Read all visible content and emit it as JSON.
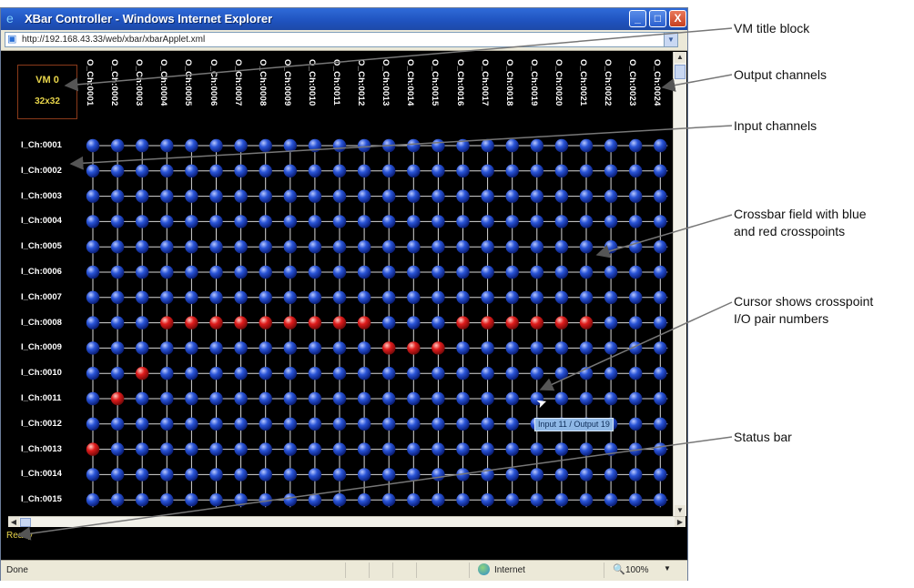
{
  "window": {
    "title": "XBar Controller - Windows Internet Explorer",
    "url": "http://192.168.43.33/web/xbar/xbarApplet.xml",
    "min_label": "_",
    "max_label": "□",
    "close_label": "X"
  },
  "vm": {
    "name": "VM 0",
    "size": "32x32"
  },
  "outputs": [
    "O_Ch:0001",
    "O_Ch:0002",
    "O_Ch:0003",
    "O_Ch:0004",
    "O_Ch:0005",
    "O_Ch:0006",
    "O_Ch:0007",
    "O_Ch:0008",
    "O_Ch:0009",
    "O_Ch:0010",
    "O_Ch:0011",
    "O_Ch:0012",
    "O_Ch:0013",
    "O_Ch:0014",
    "O_Ch:0015",
    "O_Ch:0016",
    "O_Ch:0017",
    "O_Ch:0018",
    "O_Ch:0019",
    "O_Ch:0020",
    "O_Ch:0021",
    "O_Ch:0022",
    "O_Ch:0023",
    "O_Ch:0024"
  ],
  "inputs": [
    "I_Ch:0001",
    "I_Ch:0002",
    "I_Ch:0003",
    "I_Ch:0004",
    "I_Ch:0005",
    "I_Ch:0006",
    "I_Ch:0007",
    "I_Ch:0008",
    "I_Ch:0009",
    "I_Ch:0010",
    "I_Ch:0011",
    "I_Ch:0012",
    "I_Ch:0013",
    "I_Ch:0014",
    "I_Ch:0015"
  ],
  "active_crosspoints": [
    {
      "input": 8,
      "output": 4
    },
    {
      "input": 8,
      "output": 5
    },
    {
      "input": 8,
      "output": 6
    },
    {
      "input": 8,
      "output": 7
    },
    {
      "input": 8,
      "output": 8
    },
    {
      "input": 8,
      "output": 9
    },
    {
      "input": 8,
      "output": 10
    },
    {
      "input": 8,
      "output": 11
    },
    {
      "input": 8,
      "output": 12
    },
    {
      "input": 8,
      "output": 16
    },
    {
      "input": 8,
      "output": 17
    },
    {
      "input": 8,
      "output": 18
    },
    {
      "input": 8,
      "output": 19
    },
    {
      "input": 8,
      "output": 20
    },
    {
      "input": 8,
      "output": 21
    },
    {
      "input": 9,
      "output": 13
    },
    {
      "input": 9,
      "output": 14
    },
    {
      "input": 9,
      "output": 15
    },
    {
      "input": 10,
      "output": 3
    },
    {
      "input": 11,
      "output": 2
    },
    {
      "input": 13,
      "output": 1
    }
  ],
  "colors": {
    "inactive": "#2a55d8",
    "active": "#e01c1c",
    "grid_line": "#d8d8d8"
  },
  "tooltip": "Input 11 / Output 19",
  "app_status": "Ready",
  "ie_status": {
    "left": "Done",
    "zone": "Internet",
    "zoom": "100%"
  },
  "callouts": {
    "vm_title": "VM title block",
    "outputs": "Output channels",
    "inputs": "Input channels",
    "field_line1": "Crossbar field with blue",
    "field_line2": "and red crosspoints",
    "cursor_line1": "Cursor shows crosspoint",
    "cursor_line2": "I/O pair numbers",
    "status": "Status bar"
  }
}
